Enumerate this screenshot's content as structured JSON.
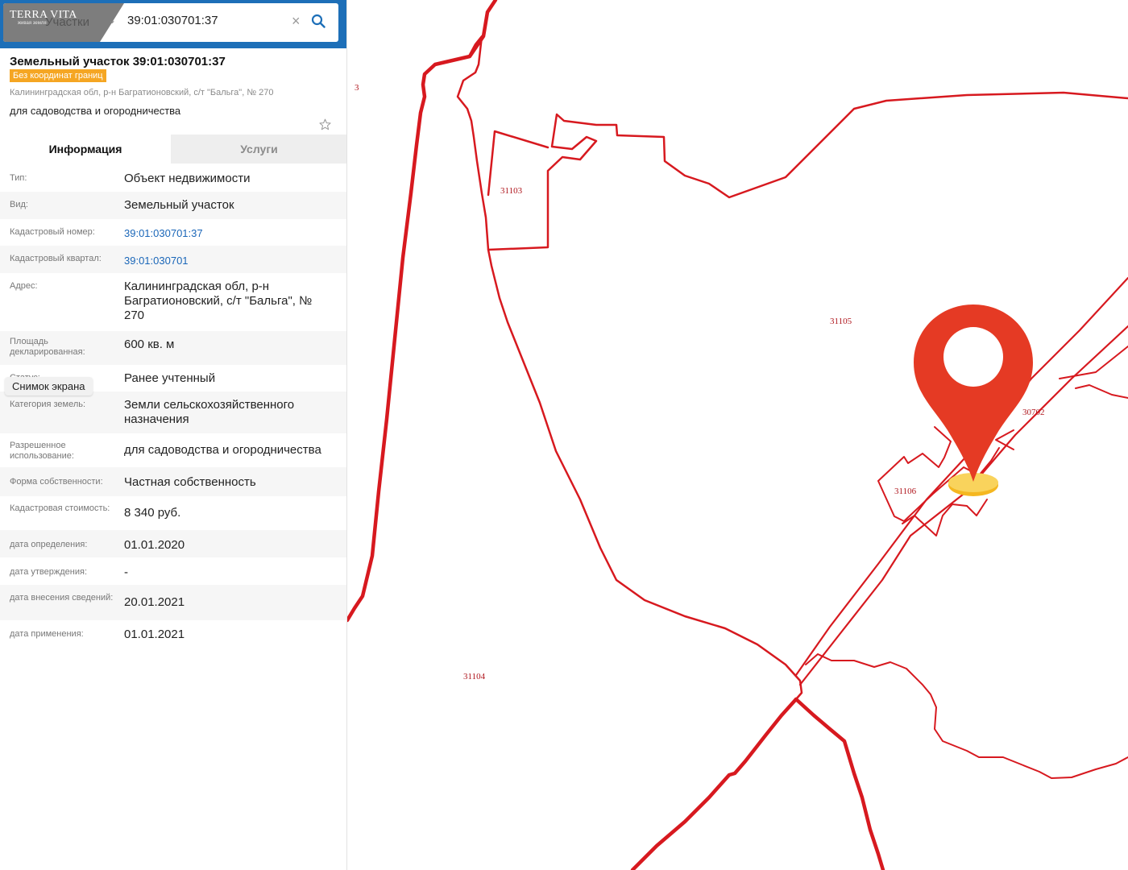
{
  "search": {
    "logo_title": "TERRA VITA",
    "logo_subtitle": "живая земля",
    "type_label": "Участки",
    "query": "39:01:030701:37"
  },
  "object": {
    "title": "Земельный участок 39:01:030701:37",
    "badge": "Без координат границ",
    "address": "Калининградская обл, р-н Багратионовский, с/т \"Бальга\", № 270",
    "usage": "для садоводства и огородничества"
  },
  "tabs": {
    "info": "Информация",
    "services": "Услуги"
  },
  "rows": [
    {
      "label": "Тип:",
      "value": "Объект недвижимости"
    },
    {
      "label": "Вид:",
      "value": "Земельный участок"
    },
    {
      "label": "Кадастровый номер:",
      "value": "39:01:030701:37"
    },
    {
      "label": "Кадастровый квартал:",
      "value": "39:01:030701"
    },
    {
      "label": "Адрес:",
      "value": "Калининградская обл, р-н Багратионовский, с/т \"Бальга\", № 270"
    },
    {
      "label": "Площадь декларированная:",
      "value": "600 кв. м"
    },
    {
      "label": "Статус:",
      "value": "Ранее учтенный"
    },
    {
      "label": "Категория земель:",
      "value": "Земли сельскохозяйственного назначения"
    },
    {
      "label": "Разрешенное использование:",
      "value": "для садоводства и огородничества"
    },
    {
      "label": "Форма собственности:",
      "value": "Частная собственность"
    },
    {
      "label": "Кадастровая стоимость:",
      "value": "8 340 руб."
    },
    {
      "label": "дата определения:",
      "value": "01.01.2020"
    },
    {
      "label": "дата утверждения:",
      "value": "-"
    },
    {
      "label": "дата внесения сведений:",
      "value": "20.01.2021"
    },
    {
      "label": "дата применения:",
      "value": "01.01.2021"
    }
  ],
  "tooltip": "Снимок экрана",
  "map": {
    "labels": [
      "3",
      "31103",
      "31105",
      "30702",
      "31106",
      "31104"
    ]
  },
  "colors": {
    "header": "#1d6fb8",
    "badge": "#f5a623",
    "boundary": "#d7191f",
    "pin": "#e53a24",
    "pin_base": "#f7c948",
    "link": "#1a66b8"
  }
}
